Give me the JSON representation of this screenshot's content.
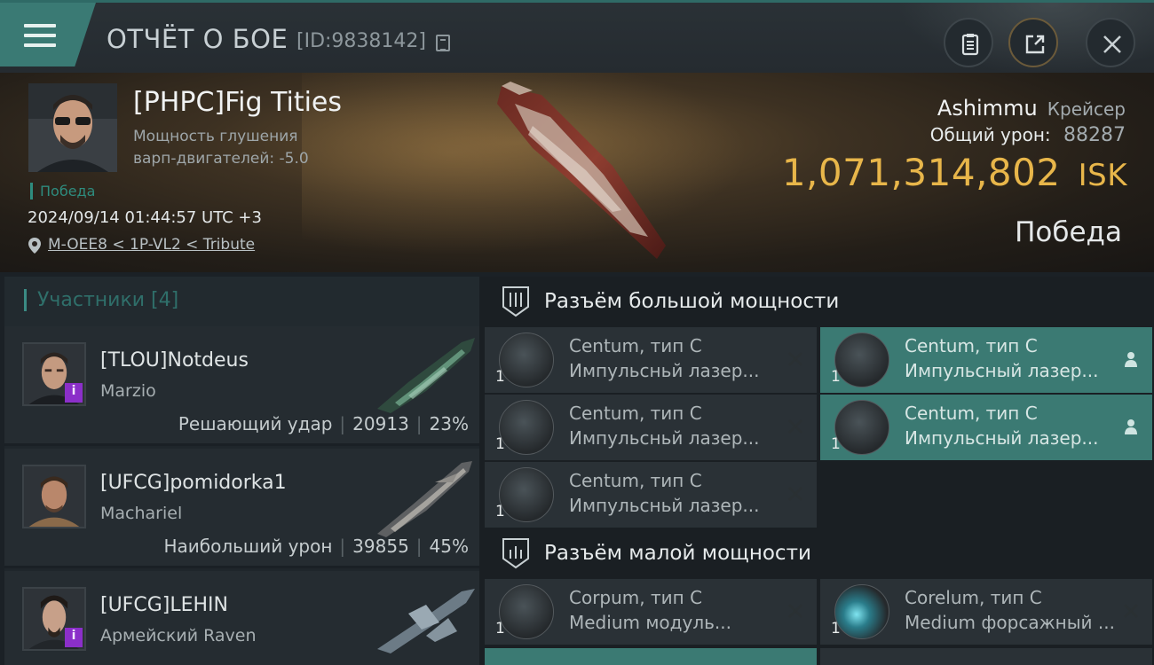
{
  "header": {
    "menu_icon": "hamburger-menu-icon",
    "title": "ОТЧЁТ О БОЕ",
    "report_id": "[ID:9838142]",
    "copy_icon": "copy-icon",
    "clipboard_icon": "clipboard-icon",
    "share_icon": "share-external-icon",
    "close_icon": "close-icon"
  },
  "victim": {
    "name": "[PHPC]Fig Tities",
    "stat_line1": "Мощность глушения",
    "stat_line2": "варп-двигателей: -5.0",
    "status": "Победа",
    "datetime": "2024/09/14 01:44:57 UTC +3",
    "location": "M-OEE8 < 1P-VL2 < Tribute",
    "ship_name": "Ashimmu",
    "ship_class": "Крейсер",
    "total_damage_label": "Общий урон:",
    "total_damage": "88287",
    "isk_value": "1,071,314,802",
    "isk_unit": "ISK",
    "result": "Победа"
  },
  "participants": {
    "title": "Участники [4]",
    "items": [
      {
        "name": "[TLOU]Notdeus",
        "ship": "Marzio",
        "role": "Решающий удар",
        "damage": "20913",
        "percent": "23%"
      },
      {
        "name": "[UFCG]pomidorka1",
        "ship": "Machariel",
        "role": "Наибольший урон",
        "damage": "39855",
        "percent": "45%"
      },
      {
        "name": "[UFCG]LEHIN",
        "ship": "Армейский Raven",
        "role": "",
        "damage": "",
        "percent": ""
      }
    ]
  },
  "fitting": {
    "high_slot_title": "Разъём большой мощности",
    "low_slot_title": "Разъём малой мощности",
    "high_modules": [
      {
        "qty": "1",
        "name": "Centum, тип C",
        "type": "Импульсньй лазер...",
        "action": "destroyed-x-icon",
        "selected": false
      },
      {
        "qty": "1",
        "name": "Centum, тип C",
        "type": "Импульсный лазер...",
        "action": "pilot-icon",
        "selected": true
      },
      {
        "qty": "1",
        "name": "Centum, тип C",
        "type": "Импульсньй лазер...",
        "action": "destroyed-x-icon",
        "selected": false
      },
      {
        "qty": "1",
        "name": "Centum, тип C",
        "type": "Импульсный лазер...",
        "action": "pilot-icon",
        "selected": true
      },
      {
        "qty": "1",
        "name": "Centum, тип C",
        "type": "Импульсньй лазер...",
        "action": "destroyed-x-icon",
        "selected": false
      }
    ],
    "low_modules": [
      {
        "qty": "1",
        "name": "Corpum, тип C",
        "type": "Medium модуль...",
        "action": "destroyed-x-icon",
        "selected": false
      },
      {
        "qty": "1",
        "name": "Corelum, тип C",
        "type": "Medium форсажный ...",
        "action": "destroyed-x-icon",
        "selected": false
      }
    ]
  },
  "colors": {
    "accent_teal": "#3b7a73",
    "isk_gold": "#e8b64a",
    "badge_purple": "#8b2fc9"
  }
}
